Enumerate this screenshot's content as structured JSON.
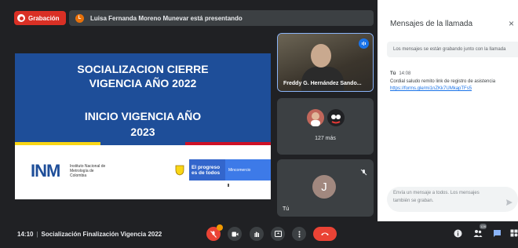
{
  "top_bar": {
    "recording_label": "Grabación",
    "presenter_initial": "L",
    "presenting_text": "Luisa Fernanda Moreno Munevar está presentando"
  },
  "slide": {
    "title_line1": "SOCIALIZACION CIERRE",
    "title_line2": "VIGENCIA AÑO 2022",
    "title_line3": "INICIO VIGENCIA AÑO",
    "title_line4": "2023",
    "logo_text": "INM",
    "logo_subtitle": "Instituto Nacional de Metrología de Colombia",
    "gov_slogan_line1": "El progreso",
    "gov_slogan_line2": "es de todos",
    "ministry": "Mincomercio",
    "stripe_colors": [
      "#f9d616",
      "#1e4e99",
      "#ce1126"
    ]
  },
  "tiles": {
    "speaker_name": "Freddy G. Hernández Sando...",
    "more_label": "127 más",
    "me_initial": "J",
    "me_label": "Tú"
  },
  "panel": {
    "title": "Mensajes de la llamada",
    "close_glyph": "×",
    "notice": "Los mensajes se están grabando junto con la llamada",
    "message": {
      "sender": "Tú",
      "time": "14:08",
      "text": "Cordial saludo remito link de registro de asistencia",
      "link": "https://forms.gle/mi1nZKk7UMkapTFs5"
    },
    "input_placeholder_line1": "Envía un mensaje a todos. Los mensajes",
    "input_placeholder_line2": "también se graban."
  },
  "bottom_bar": {
    "time": "14:10",
    "meeting_title": "Socialización Finalización Vigencia 2022",
    "participant_count": "128"
  },
  "icons": [
    "record-icon",
    "mic-off-icon",
    "camera-icon",
    "raise-hand-icon",
    "present-icon",
    "more-options-icon",
    "hang-up-icon",
    "info-icon",
    "people-icon",
    "chat-icon",
    "activities-icon",
    "send-icon",
    "speaking-icon"
  ],
  "colors": {
    "accent_blue": "#1a73e8",
    "recording_red": "#d93025",
    "dark_bg": "#202124",
    "slide_blue": "#1e4e99"
  }
}
